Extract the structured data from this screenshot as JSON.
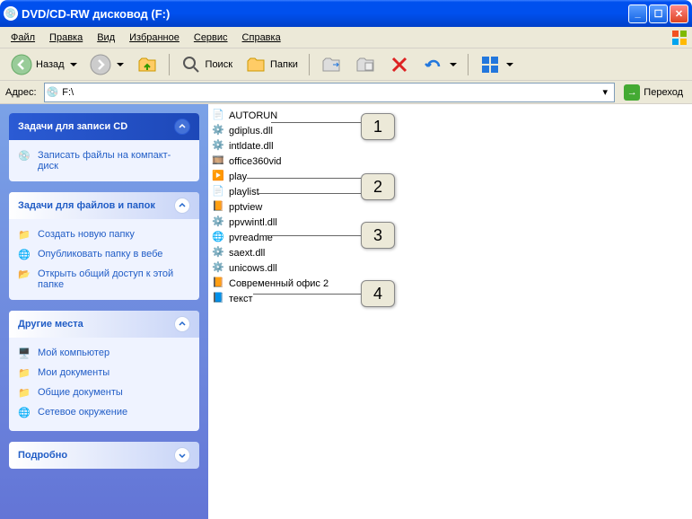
{
  "title": "DVD/CD-RW дисковод (F:)",
  "menu": {
    "file": "Файл",
    "edit": "Правка",
    "view": "Вид",
    "favorites": "Избранное",
    "tools": "Сервис",
    "help": "Справка"
  },
  "toolbar": {
    "back": "Назад",
    "search": "Поиск",
    "folders": "Папки"
  },
  "address": {
    "label": "Адрес:",
    "value": "F:\\",
    "go": "Переход"
  },
  "panels": {
    "cd": {
      "title": "Задачи для записи CD",
      "items": [
        {
          "label": "Записать файлы на компакт-диск"
        }
      ]
    },
    "filetasks": {
      "title": "Задачи для файлов и папок",
      "items": [
        {
          "label": "Создать новую папку"
        },
        {
          "label": "Опубликовать папку в вебе"
        },
        {
          "label": "Открыть общий доступ к этой папке"
        }
      ]
    },
    "places": {
      "title": "Другие места",
      "items": [
        {
          "label": "Мой компьютер"
        },
        {
          "label": "Мои документы"
        },
        {
          "label": "Общие документы"
        },
        {
          "label": "Сетевое окружение"
        }
      ]
    },
    "details": {
      "title": "Подробно"
    }
  },
  "files": [
    {
      "name": "AUTORUN",
      "icon": "ini"
    },
    {
      "name": "gdiplus.dll",
      "icon": "dll"
    },
    {
      "name": "intldate.dll",
      "icon": "dll"
    },
    {
      "name": "office360vid",
      "icon": "media"
    },
    {
      "name": "play",
      "icon": "bat"
    },
    {
      "name": "playlist",
      "icon": "txt"
    },
    {
      "name": "pptview",
      "icon": "ppt"
    },
    {
      "name": "ppvwintl.dll",
      "icon": "dll"
    },
    {
      "name": "pvreadme",
      "icon": "htm"
    },
    {
      "name": "saext.dll",
      "icon": "dll"
    },
    {
      "name": "unicows.dll",
      "icon": "dll"
    },
    {
      "name": "Современный офис 2",
      "icon": "ppt"
    },
    {
      "name": "текст",
      "icon": "doc"
    }
  ],
  "callouts": [
    "1",
    "2",
    "3",
    "4"
  ]
}
